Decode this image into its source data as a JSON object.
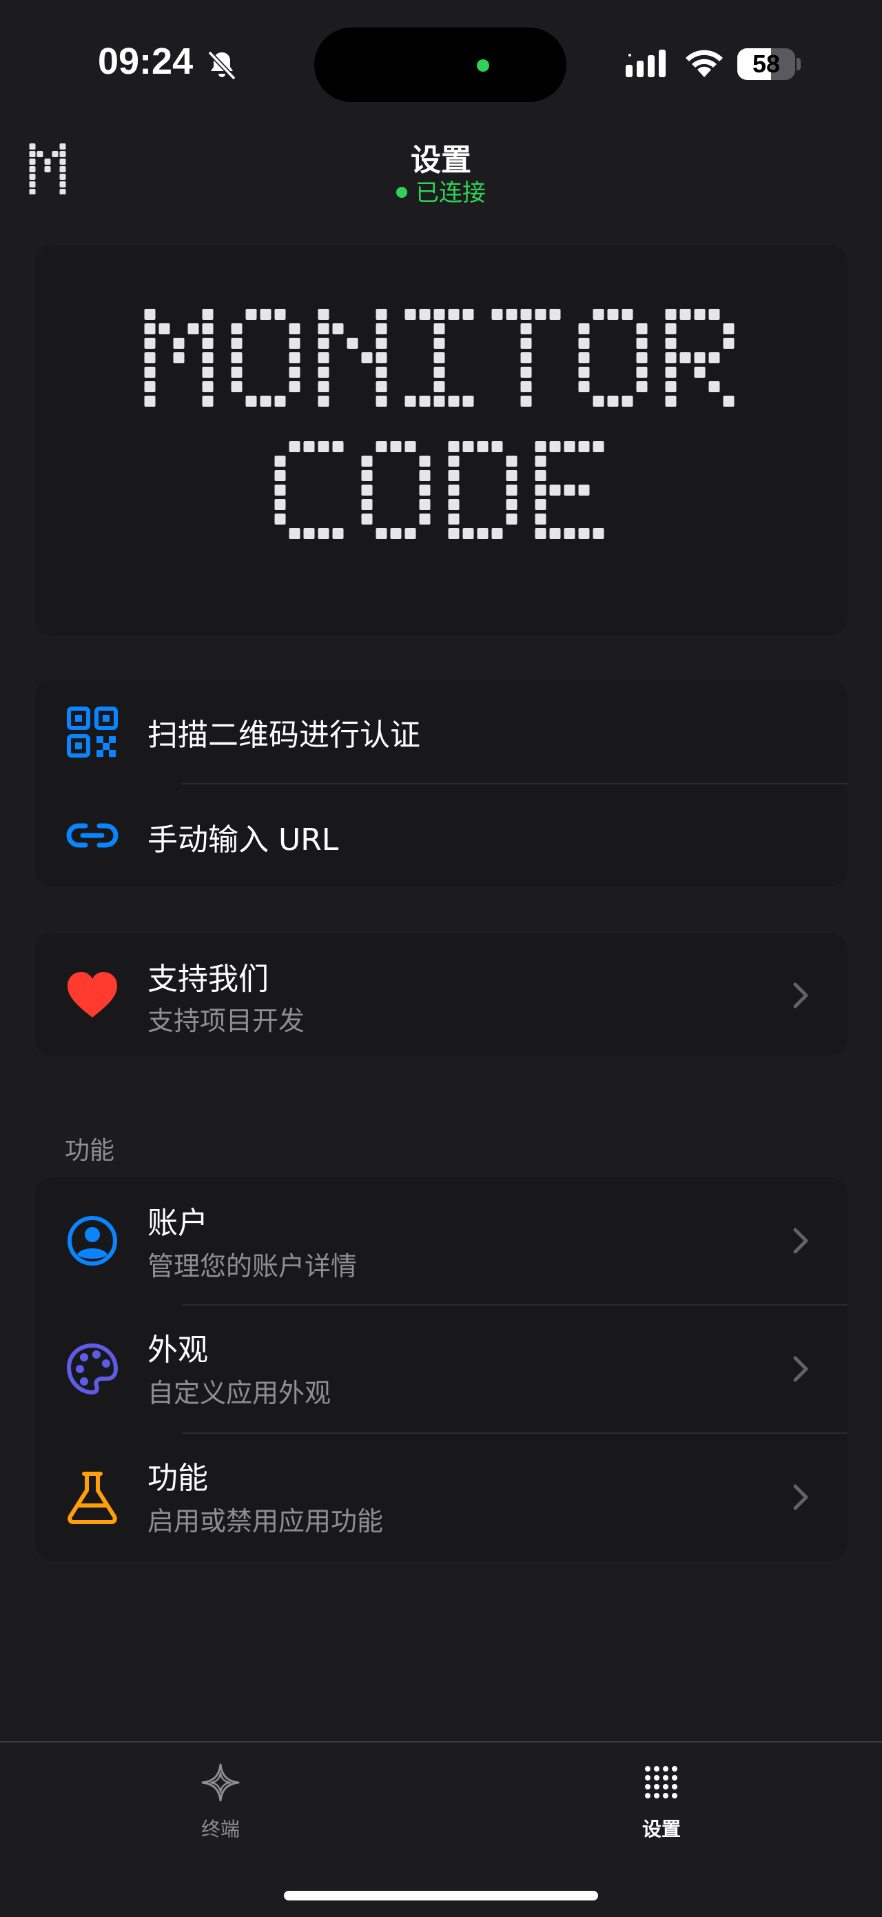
{
  "status_bar": {
    "time": "09:24",
    "battery": "58",
    "battery_level": 0.58
  },
  "header": {
    "title": "设置",
    "connection_status": "已连接",
    "status_color": "#30d158"
  },
  "hero": {
    "line1": "MONITOR",
    "line2": "CODE"
  },
  "auth": {
    "items": [
      {
        "label": "扫描二维码进行认证",
        "icon": "qr-code-icon"
      },
      {
        "label": "手动输入 URL",
        "icon": "link-icon"
      }
    ]
  },
  "support": {
    "label": "支持我们",
    "sublabel": "支持项目开发",
    "icon": "heart-icon",
    "icon_color": "#ff3b30"
  },
  "features": {
    "section_label": "功能",
    "items": [
      {
        "label": "账户",
        "sublabel": "管理您的账户详情",
        "icon": "person-circle-icon",
        "icon_color": "#0a84ff"
      },
      {
        "label": "外观",
        "sublabel": "自定义应用外观",
        "icon": "palette-icon",
        "icon_color": "#5e5ce6"
      },
      {
        "label": "功能",
        "sublabel": "启用或禁用应用功能",
        "icon": "flask-icon",
        "icon_color": "#ff9f0a"
      }
    ]
  },
  "tabbar": {
    "tabs": [
      {
        "label": "终端",
        "icon": "sparkle-icon",
        "active": false
      },
      {
        "label": "设置",
        "icon": "grid-dots-icon",
        "active": true
      }
    ]
  },
  "colors": {
    "background": "#1c1c1e",
    "card": "#18181b",
    "accent_blue": "#0a84ff",
    "secondary_text": "#8e8e93"
  }
}
